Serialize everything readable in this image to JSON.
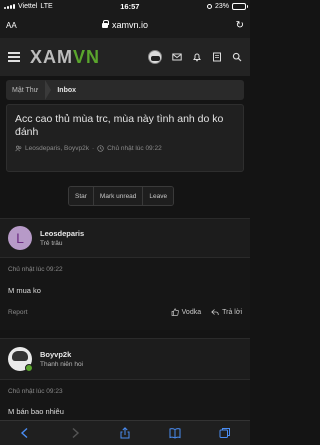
{
  "status_bar": {
    "carrier": "Viettel",
    "network": "LTE",
    "time": "16:57",
    "battery_text": "23%",
    "battery_level": 0.23
  },
  "browser": {
    "aa_label": "AA",
    "url": "xamvn.io"
  },
  "site": {
    "logo_left": "XAM",
    "logo_right": "VN",
    "brand_color": "#5aa52d"
  },
  "breadcrumb": {
    "items": [
      {
        "label": "Mật Thư"
      },
      {
        "label": "Inbox"
      }
    ]
  },
  "thread": {
    "title": "Acc cao thủ mùa trc, mùa này tình anh do ko đánh",
    "participants": "Leosdeparis, Boyvp2k",
    "date": "Chủ nhật lúc 09:22"
  },
  "actions": {
    "star": "Star",
    "mark_unread": "Mark unread",
    "leave": "Leave"
  },
  "messages": [
    {
      "avatar_letter": "L",
      "username": "Leosdeparis",
      "user_title": "Trẻ trâu",
      "timestamp": "Chủ nhật lúc 09:22",
      "text": "M mua ko",
      "report": "Report",
      "react_label": "Vodka",
      "reply_label": "Trả lời"
    },
    {
      "username": "Boyvp2k",
      "user_title": "Thanh niên hoi",
      "timestamp": "Chủ nhật lúc 09:23",
      "text": "M bán bao nhiêu"
    }
  ]
}
